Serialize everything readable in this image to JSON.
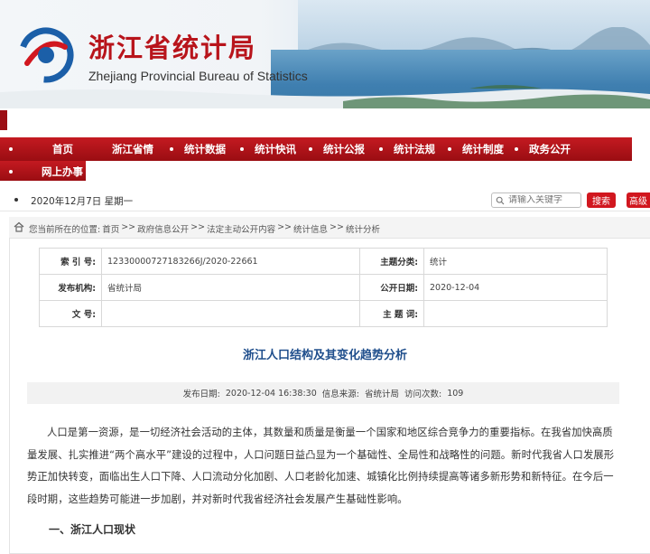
{
  "header": {
    "title_cn": "浙江省统计局",
    "title_en": "Zhejiang Provincial Bureau of Statistics",
    "logo_icon": "bureau-logo-icon",
    "brand_color": "#b8141b"
  },
  "nav": {
    "items": [
      {
        "label": "首页"
      },
      {
        "label": "浙江省情"
      },
      {
        "label": "统计数据"
      },
      {
        "label": "统计快讯"
      },
      {
        "label": "统计公报"
      },
      {
        "label": "统计法规"
      },
      {
        "label": "统计制度"
      },
      {
        "label": "政务公开"
      },
      {
        "label": "网上办事"
      }
    ],
    "bar_color": "#b5141a"
  },
  "topbar": {
    "date": "2020年12月7日 星期一",
    "search_placeholder": "请输入关键字",
    "search_button": "搜索",
    "advanced_button": "高级"
  },
  "breadcrumb": {
    "prefix": "您当前所在的位置:",
    "items": [
      "首页",
      ">>",
      "政府信息公开",
      ">>",
      "法定主动公开内容",
      ">>",
      "统计信息",
      ">>",
      "统计分析"
    ]
  },
  "meta_table": {
    "index_label": "索 引 号:",
    "index_value": "12330000727183266J/2020-22661",
    "category_label": "主题分类:",
    "category_value": "统计",
    "publisher_label": "发布机构:",
    "publisher_value": "省统计局",
    "pubdate_label": "公开日期:",
    "pubdate_value": "2020-12-04",
    "docno_label": "文 号:",
    "docno_value": "",
    "keywords_label": "主 题 词:",
    "keywords_value": ""
  },
  "article": {
    "title": "浙江人口结构及其变化趋势分析",
    "info": {
      "date_label": "发布日期:",
      "date_value": "2020-12-04 16:38:30",
      "source_label": "信息来源:",
      "source_value": "省统计局",
      "visits_label": "访问次数:",
      "visits_value": "109"
    },
    "paragraph": "人口是第一资源，是一切经济社会活动的主体，其数量和质量是衡量一个国家和地区综合竞争力的重要指标。在我省加快高质量发展、扎实推进“两个高水平”建设的过程中，人口问题日益凸显为一个基础性、全局性和战略性的问题。新时代我省人口发展形势正加快转变，面临出生人口下降、人口流动分化加剧、人口老龄化加速、城镇化比例持续提高等诸多新形势和新特征。在今后一段时期，这些趋势可能进一步加剧，并对新时代我省经济社会发展产生基础性影响。",
    "section_heading": "一、浙江人口现状"
  }
}
